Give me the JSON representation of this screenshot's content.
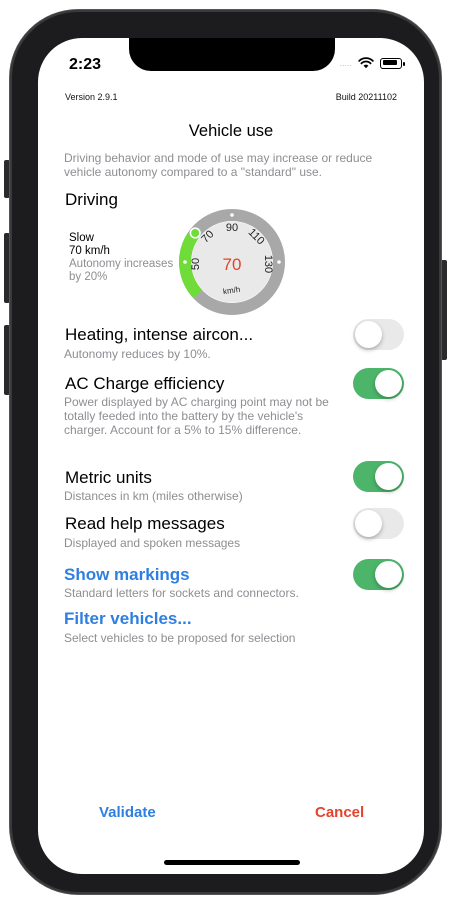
{
  "status_bar": {
    "time": "2:23",
    "signal": "....."
  },
  "header": {
    "version": "Version 2.9.1",
    "build": "Build 20211102"
  },
  "page": {
    "title": "Vehicle use",
    "intro": "Driving behavior and mode of use may increase or reduce vehicle autonomy compared to a \"standard\" use."
  },
  "driving": {
    "title": "Driving",
    "speed_name": "Slow",
    "speed_value": "70 km/h",
    "autonomy_note": "Autonomy increases by 20%",
    "gauge": {
      "current": "70",
      "unit": "km/h",
      "ticks": [
        "50",
        "70",
        "90",
        "110",
        "130"
      ],
      "accent_color": "#6fdc3a",
      "value_color": "#e5432c"
    }
  },
  "settings": [
    {
      "title": "Heating, intense aircon...",
      "subtitle": "Autonomy reduces by 10%.",
      "enabled": false
    },
    {
      "title": "AC Charge efficiency",
      "subtitle": "Power displayed by AC charging point may not be totally feeded into the battery by the vehicle's charger. Account for a 5% to 15% difference.",
      "enabled": true
    },
    {
      "title": "Metric units",
      "subtitle": "Distances in km (miles otherwise)",
      "enabled": true
    },
    {
      "title": "Read help messages",
      "subtitle": "Displayed and spoken messages",
      "enabled": false
    },
    {
      "title": "Show markings",
      "subtitle": "Standard letters for sockets and connectors.",
      "enabled": true
    }
  ],
  "filter": {
    "title": "Filter vehicles...",
    "subtitle": "Select vehicles to be proposed for selection"
  },
  "footer": {
    "validate_label": "Validate",
    "cancel_label": "Cancel"
  },
  "colors": {
    "link": "#2f7fe0",
    "toggle_on": "#4cb56a",
    "toggle_off": "#e9e9ea",
    "cancel": "#e5432c",
    "secondary_text": "#8e8e93"
  }
}
